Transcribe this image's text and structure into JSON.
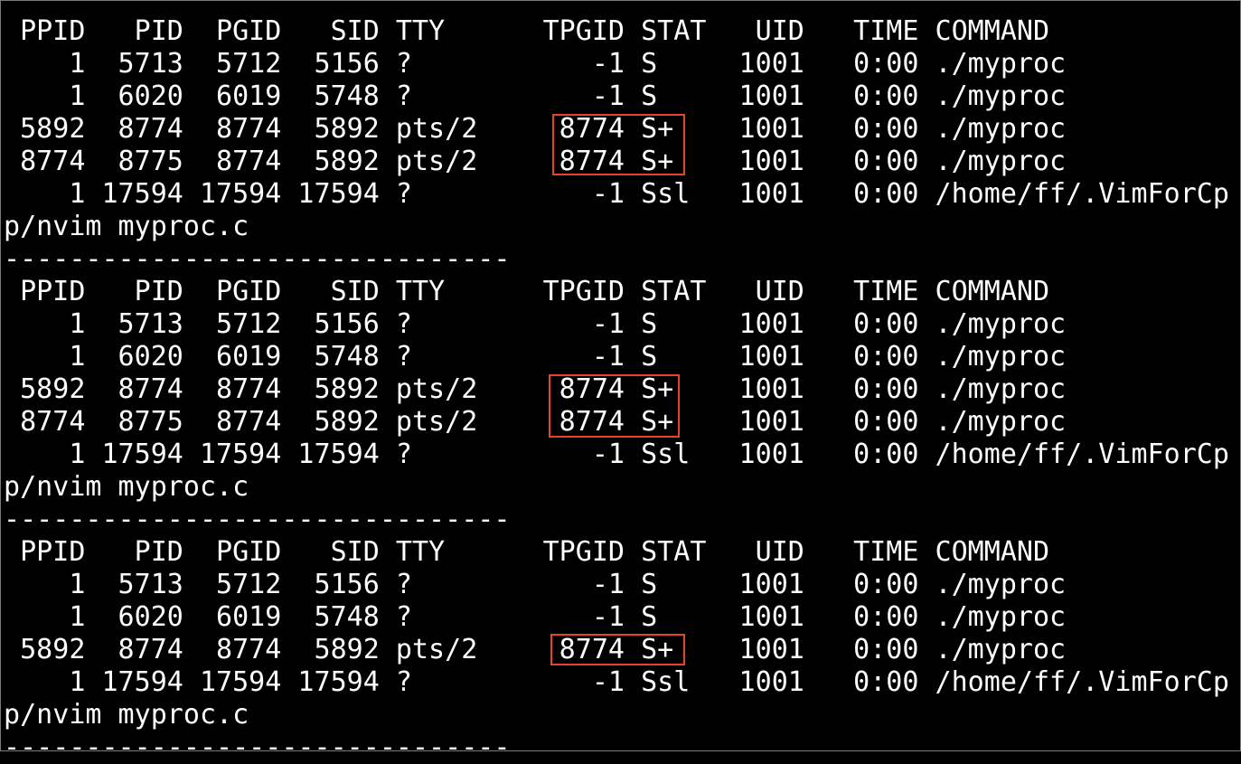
{
  "terminal": {
    "background": "#000000",
    "foreground": "#ffffff",
    "highlight_color": "#e8432a",
    "lines": [
      "-------------------------------",
      " PPID   PID  PGID   SID TTY      TPGID STAT   UID   TIME COMMAND",
      "    1  5713  5712  5156 ?           -1 S     1001   0:00 ./myproc",
      "    1  6020  6019  5748 ?           -1 S     1001   0:00 ./myproc",
      " 5892  8774  8774  5892 pts/2     8774 S+    1001   0:00 ./myproc",
      " 8774  8775  8774  5892 pts/2     8774 S+    1001   0:00 ./myproc",
      "    1 17594 17594 17594 ?           -1 Ssl   1001   0:00 /home/ff/.VimForCp",
      "p/nvim myproc.c",
      "-------------------------------",
      " PPID   PID  PGID   SID TTY      TPGID STAT   UID   TIME COMMAND",
      "    1  5713  5712  5156 ?           -1 S     1001   0:00 ./myproc",
      "    1  6020  6019  5748 ?           -1 S     1001   0:00 ./myproc",
      " 5892  8774  8774  5892 pts/2     8774 S+    1001   0:00 ./myproc",
      " 8774  8775  8774  5892 pts/2     8774 S+    1001   0:00 ./myproc",
      "    1 17594 17594 17594 ?           -1 Ssl   1001   0:00 /home/ff/.VimForCp",
      "p/nvim myproc.c",
      "-------------------------------",
      " PPID   PID  PGID   SID TTY      TPGID STAT   UID   TIME COMMAND",
      "    1  5713  5712  5156 ?           -1 S     1001   0:00 ./myproc",
      "    1  6020  6019  5748 ?           -1 S     1001   0:00 ./myproc",
      " 5892  8774  8774  5892 pts/2     8774 S+    1001   0:00 ./myproc",
      "    1 17594 17594 17594 ?           -1 Ssl   1001   0:00 /home/ff/.VimForCp",
      "p/nvim myproc.c",
      "-------------------------------"
    ]
  }
}
